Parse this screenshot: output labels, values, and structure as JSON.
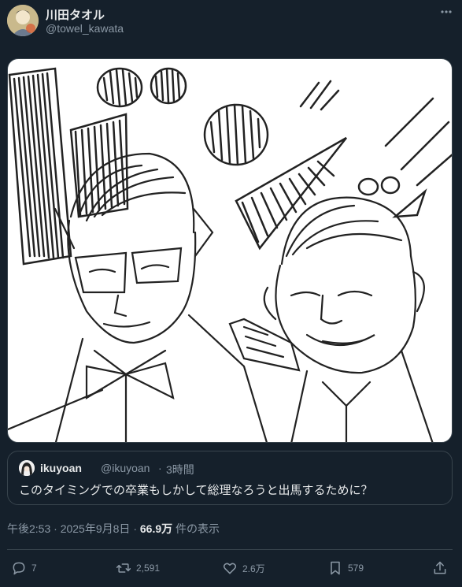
{
  "author": {
    "display_name": "川田タオル",
    "handle": "@towel_kawata",
    "avatar_icon": "avatar-image"
  },
  "more_icon": "ellipsis-icon",
  "quote": {
    "name": "ikuyoan",
    "handle": "@ikuyoan",
    "separator": "·",
    "time": "3時間",
    "text": "このタイミングでの卒業もしかして総理なろうと出馬するために？"
  },
  "meta": {
    "time": "午後2:53",
    "sep1": "·",
    "date": "2025年9月8日",
    "sep2": "·",
    "views": "66.9万",
    "views_suffix": "件の表示"
  },
  "actions": {
    "reply": {
      "icon": "reply-icon",
      "count": "7"
    },
    "retweet": {
      "icon": "retweet-icon",
      "count": "2,591"
    },
    "like": {
      "icon": "heart-icon",
      "count": "2.6万"
    },
    "bookmark": {
      "icon": "bookmark-icon",
      "count": "579"
    },
    "share": {
      "icon": "share-icon"
    }
  },
  "colors": {
    "background": "#15202b",
    "text": "#e7e9ea",
    "muted": "#8b98a5",
    "border": "#38444d"
  }
}
